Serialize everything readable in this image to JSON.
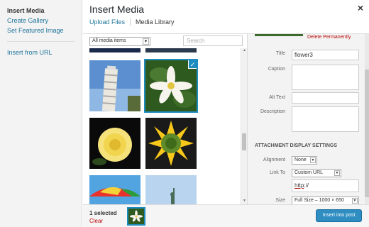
{
  "menu": {
    "active": "Insert Media",
    "items": [
      "Create Gallery",
      "Set Featured Image"
    ],
    "extra": "Insert from URL"
  },
  "header": {
    "title": "Insert Media",
    "close": "×",
    "tabs": [
      "Upload Files",
      "Media Library"
    ]
  },
  "browser": {
    "filter_value": "All media items",
    "search_placeholder": "Search",
    "thumbnails": [
      {
        "name": "leaning-tower",
        "selected": false
      },
      {
        "name": "flower3",
        "selected": true
      },
      {
        "name": "yellow-rose",
        "selected": false
      },
      {
        "name": "sunflower",
        "selected": false
      },
      {
        "name": "beach-umbrella",
        "selected": false
      },
      {
        "name": "statue-of-liberty",
        "selected": false
      }
    ]
  },
  "sidebar": {
    "delete_link": "Delete Permanently",
    "fields": {
      "title_label": "Title",
      "title_value": "flower3",
      "caption_label": "Caption",
      "caption_value": "",
      "alt_label": "Alt Text",
      "alt_value": "",
      "description_label": "Description",
      "description_value": ""
    },
    "display_settings": {
      "heading": "ATTACHMENT DISPLAY SETTINGS",
      "alignment_label": "Alignment",
      "alignment_value": "None",
      "link_label": "Link To",
      "link_value": "Custom URL",
      "url_prefix": "http",
      "url_suffix": "://",
      "size_label": "Size",
      "size_value": "Full Size – 1000 × 650"
    }
  },
  "toolbar": {
    "selected_count": "1 selected",
    "clear_label": "Clear",
    "insert_label": "Insert into post"
  },
  "colors": {
    "link": "#21759b",
    "accent": "#1e8cbe",
    "danger": "#bc0b0b",
    "button": "#2e8dc1"
  }
}
